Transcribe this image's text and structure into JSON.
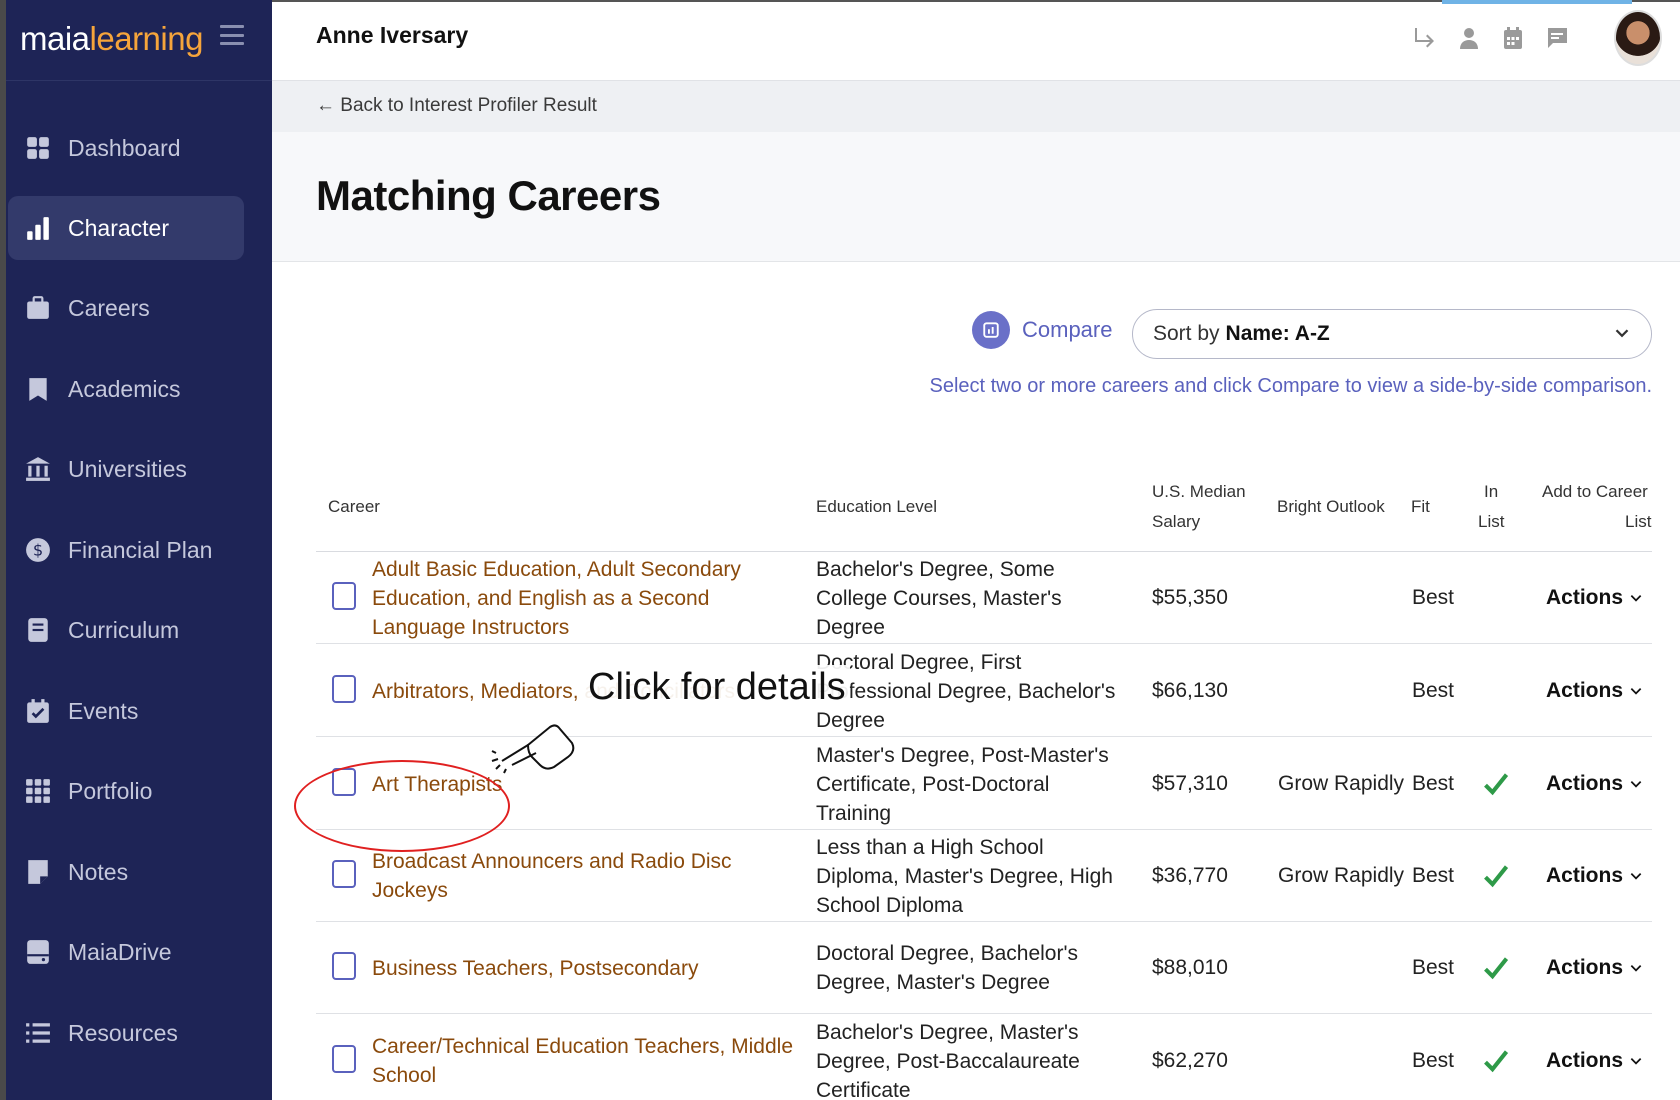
{
  "app": {
    "logo_part1": "maia",
    "logo_part2": "learning"
  },
  "sidebar": {
    "items": [
      {
        "label": "Dashboard",
        "icon": "dashboard-icon"
      },
      {
        "label": "Character",
        "icon": "bar-chart-icon",
        "active": true
      },
      {
        "label": "Careers",
        "icon": "briefcase-icon"
      },
      {
        "label": "Academics",
        "icon": "bookmark-icon"
      },
      {
        "label": "Universities",
        "icon": "university-icon"
      },
      {
        "label": "Financial Plan",
        "icon": "dollar-icon"
      },
      {
        "label": "Curriculum",
        "icon": "book-icon"
      },
      {
        "label": "Events",
        "icon": "calendar-check-icon"
      },
      {
        "label": "Portfolio",
        "icon": "grid-icon"
      },
      {
        "label": "Notes",
        "icon": "note-icon"
      },
      {
        "label": "MaiaDrive",
        "icon": "drive-icon"
      },
      {
        "label": "Resources",
        "icon": "list-icon"
      }
    ]
  },
  "topbar": {
    "user_name": "Anne Iversary",
    "icons": [
      "redirect-icon",
      "person-icon",
      "calendar-icon",
      "message-icon"
    ]
  },
  "breadcrumb": {
    "back_label": "← Back to Interest Profiler Result"
  },
  "page": {
    "title": "Matching Careers"
  },
  "toolbar": {
    "compare_label": "Compare",
    "sort_prefix": "Sort by",
    "sort_value": "Name: A-Z",
    "hint": "Select two or more careers and click Compare to view a side-by-side comparison."
  },
  "table": {
    "headers": {
      "career": "Career",
      "education": "Education Level",
      "salary_line1": "U.S. Median",
      "salary_line2": "Salary",
      "outlook": "Bright Outlook",
      "fit": "Fit",
      "inlist_line1": "In",
      "inlist_line2": "List",
      "add_line1": "Add to Career",
      "add_line2": "List"
    },
    "rows": [
      {
        "career": "Adult Basic Education, Adult Secondary Education, and English as a Second Language Instructors",
        "education": "Bachelor's Degree, Some College Courses, Master's Degree",
        "salary": "$55,350",
        "outlook": "",
        "fit": "Best",
        "in_list": false,
        "action": "Actions"
      },
      {
        "career": "Arbitrators, Mediators, and Conciliators",
        "education": "Doctoral Degree, First Professional Degree, Bachelor's Degree",
        "salary": "$66,130",
        "outlook": "",
        "fit": "Best",
        "in_list": false,
        "action": "Actions"
      },
      {
        "career": "Art Therapists",
        "education": "Master's Degree, Post-Master's Certificate, Post-Doctoral Training",
        "salary": "$57,310",
        "outlook": "Grow Rapidly",
        "fit": "Best",
        "in_list": true,
        "action": "Actions"
      },
      {
        "career": "Broadcast Announcers and Radio Disc Jockeys",
        "education": "Less than a High School Diploma, Master's Degree, High School Diploma",
        "salary": "$36,770",
        "outlook": "Grow Rapidly",
        "fit": "Best",
        "in_list": true,
        "action": "Actions"
      },
      {
        "career": "Business Teachers, Postsecondary",
        "education": "Doctoral Degree, Bachelor's Degree, Master's Degree",
        "salary": "$88,010",
        "outlook": "",
        "fit": "Best",
        "in_list": true,
        "action": "Actions"
      },
      {
        "career": "Career/Technical Education Teachers, Middle School",
        "education": "Bachelor's Degree, Master's Degree, Post-Baccalaureate Certificate",
        "salary": "$62,270",
        "outlook": "",
        "fit": "Best",
        "in_list": true,
        "action": "Actions"
      }
    ]
  },
  "overlay": {
    "callout": "Click for details"
  },
  "colors": {
    "sidebar_bg": "#1e2456",
    "accent": "#5a61bd",
    "career_link": "#8a4a0c",
    "check": "#2e9a48",
    "logo_orange": "#f6a53b"
  }
}
